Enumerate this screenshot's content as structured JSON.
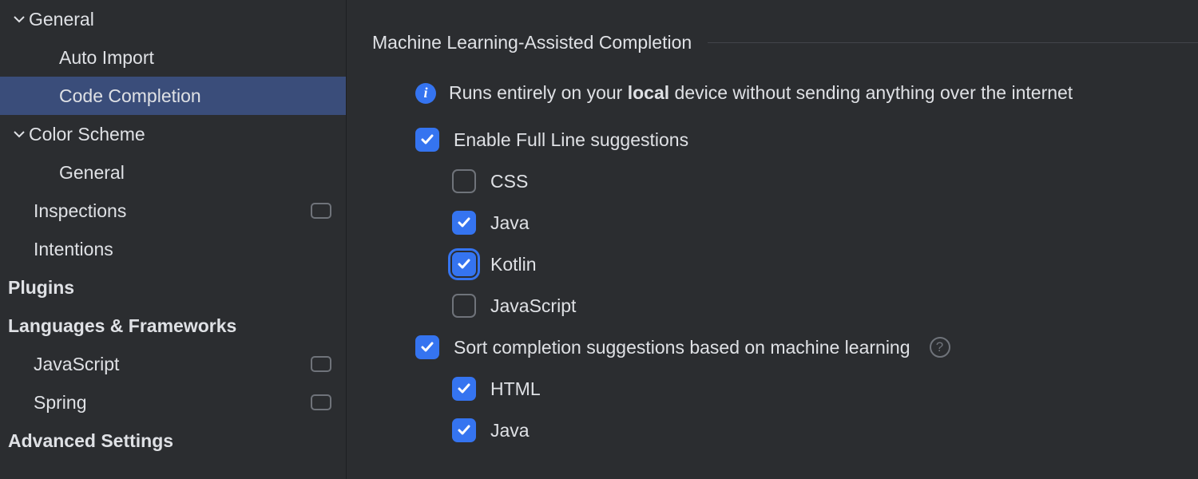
{
  "sidebar": {
    "items": [
      {
        "label": "General",
        "expanded": true,
        "level": 0,
        "bold": false,
        "hasChevron": true
      },
      {
        "label": "Auto Import",
        "level": 2,
        "bold": false
      },
      {
        "label": "Code Completion",
        "level": 2,
        "bold": false,
        "selected": true
      },
      {
        "label": "Color Scheme",
        "expanded": true,
        "level": 1,
        "bold": false,
        "hasChevron": true
      },
      {
        "label": "General",
        "level": 2,
        "bold": false
      },
      {
        "label": "Inspections",
        "level": 1,
        "bold": false,
        "tag": true
      },
      {
        "label": "Intentions",
        "level": 1,
        "bold": false
      },
      {
        "label": "Plugins",
        "level": 0,
        "bold": true
      },
      {
        "label": "Languages & Frameworks",
        "level": 0,
        "bold": true
      },
      {
        "label": "JavaScript",
        "level": 1,
        "bold": false,
        "tag": true
      },
      {
        "label": "Spring",
        "level": 1,
        "bold": false,
        "tag": true
      },
      {
        "label": "Advanced Settings",
        "level": 0,
        "bold": true
      }
    ]
  },
  "main": {
    "sectionTitle": "Machine Learning-Assisted Completion",
    "infoPrefix": "Runs entirely on your ",
    "infoBold": "local",
    "infoSuffix": " device without sending anything over the internet",
    "enableFullLine": {
      "label": "Enable Full Line suggestions",
      "checked": true,
      "langs": [
        {
          "label": "CSS",
          "checked": false
        },
        {
          "label": "Java",
          "checked": true
        },
        {
          "label": "Kotlin",
          "checked": true,
          "focused": true
        },
        {
          "label": "JavaScript",
          "checked": false
        }
      ]
    },
    "sortCompletion": {
      "label": "Sort completion suggestions based on machine learning",
      "checked": true,
      "langs": [
        {
          "label": "HTML",
          "checked": true
        },
        {
          "label": "Java",
          "checked": true
        }
      ]
    }
  }
}
